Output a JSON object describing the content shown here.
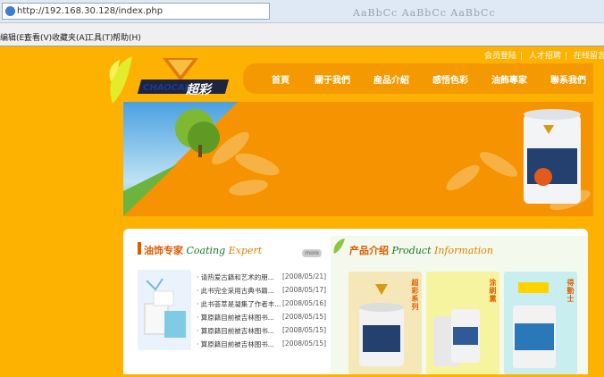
{
  "browser": {
    "url": "http://192.168.30.128/index.php",
    "ghost_text": "AaBbCc AaBbCc AaBbCc",
    "menu": [
      "编辑(E)",
      "查看(V)",
      "收藏夹(A)",
      "工具(T)",
      "帮助(H)"
    ]
  },
  "site": {
    "top_links": [
      "会员登陆",
      "人才招聘",
      "在线留言"
    ],
    "logo_en": "CHAOCAI",
    "logo_cn": "超彩",
    "nav": [
      "首頁",
      "關于我們",
      "産品介紹",
      "感悟色彩",
      "油飾專家",
      "聯系我們"
    ]
  },
  "expert": {
    "title_cn": "油饰专家",
    "title_en_a": "Coating",
    "title_en_b": "Expert",
    "more": "more",
    "news": [
      {
        "title": "· 请热爱古籍和艺术的朋...",
        "date": "[2008/05/21]"
      },
      {
        "title": "· 此书完全采用古典书籍...",
        "date": "[2008/05/17]"
      },
      {
        "title": "· 此书荟萃是凝集了作者丰...",
        "date": "[2008/05/16]"
      },
      {
        "title": "· 算原籍目前被吉林图书...",
        "date": "[2008/05/15]"
      },
      {
        "title": "· 算原籍目前被吉林图书...",
        "date": "[2008/05/15]"
      },
      {
        "title": "· 算原籍目前被吉林图书...",
        "date": "[2008/05/15]"
      }
    ]
  },
  "products": {
    "title_cn": "产品介绍",
    "title_en_a": "Product",
    "title_en_b": "Information",
    "items": [
      {
        "label": "超彩系列",
        "bg": "#f5e7b8"
      },
      {
        "label": "涂刷黨",
        "bg": "#f7f4a0"
      },
      {
        "label": "得動士",
        "bg": "#c9eef0"
      }
    ]
  },
  "colors": {
    "page_bg": "#fdb100",
    "nav_bg": "#f49a00",
    "accent": "#e05a00"
  }
}
